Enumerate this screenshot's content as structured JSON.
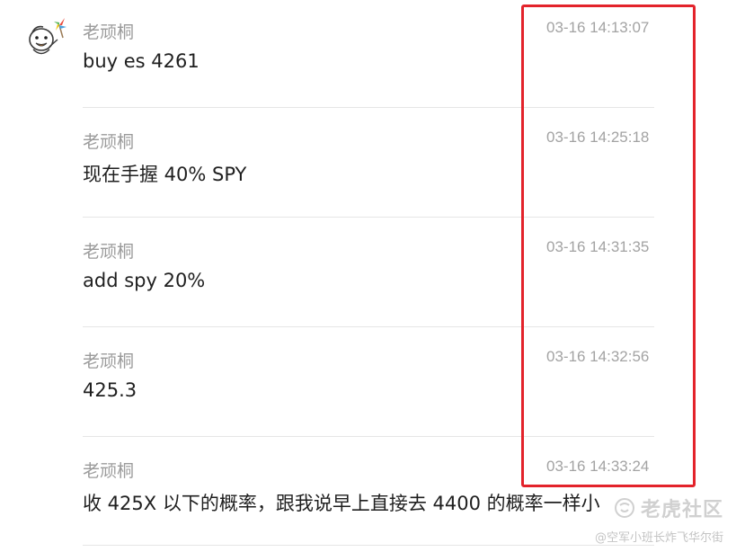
{
  "messages": [
    {
      "author": "老顽桐",
      "time": "03-16 14:13:07",
      "content": "buy es 4261"
    },
    {
      "author": "老顽桐",
      "time": "03-16 14:25:18",
      "content": "现在手握 40% SPY"
    },
    {
      "author": "老顽桐",
      "time": "03-16 14:31:35",
      "content": "add spy 20%"
    },
    {
      "author": "老顽桐",
      "time": "03-16 14:32:56",
      "content": "425.3"
    },
    {
      "author": "老顽桐",
      "time": "03-16 14:33:24",
      "content": "收 425X 以下的概率，跟我说早上直接去 4400 的概率一样小"
    }
  ],
  "watermark": {
    "brand": "老虎社区",
    "handle": "@空军小班长炸飞华尔街"
  },
  "colors": {
    "highlight_border": "#e3232b",
    "author_text": "#9b9b9b",
    "time_text": "#a3a3a3",
    "content_text": "#1f1f1f"
  },
  "icons": {
    "avatar": "cartoon-face-with-pinwheel-icon",
    "watermark_logo": "tiger-logo-icon"
  }
}
